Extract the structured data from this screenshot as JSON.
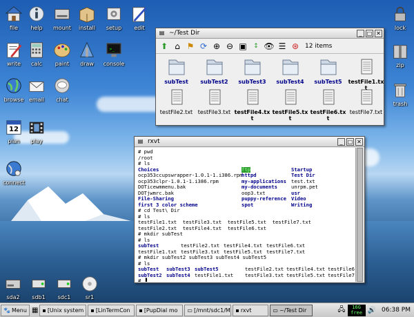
{
  "desktop_left": [
    {
      "name": "file",
      "icon": "home-icon",
      "col": 0,
      "row": 0
    },
    {
      "name": "help",
      "icon": "info-icon",
      "col": 1,
      "row": 0
    },
    {
      "name": "mount",
      "icon": "drive-icon",
      "col": 2,
      "row": 0
    },
    {
      "name": "install",
      "icon": "package-icon",
      "col": 3,
      "row": 0
    },
    {
      "name": "setup",
      "icon": "setup-icon",
      "col": 4,
      "row": 0
    },
    {
      "name": "edit",
      "icon": "edit-icon",
      "col": 5,
      "row": 0
    },
    {
      "name": "write",
      "icon": "write-icon",
      "col": 0,
      "row": 1
    },
    {
      "name": "calc",
      "icon": "calculator-icon",
      "col": 1,
      "row": 1
    },
    {
      "name": "paint",
      "icon": "paint-icon",
      "col": 2,
      "row": 1
    },
    {
      "name": "draw",
      "icon": "draw-icon",
      "col": 3,
      "row": 1
    },
    {
      "name": "console",
      "icon": "monitor-icon",
      "col": 4,
      "row": 1
    },
    {
      "name": "browse",
      "icon": "globe-icon",
      "col": 0,
      "row": 2
    },
    {
      "name": "email",
      "icon": "email-icon",
      "col": 1,
      "row": 2
    },
    {
      "name": "chat",
      "icon": "chat-icon",
      "col": 2,
      "row": 2
    },
    {
      "name": "plan",
      "icon": "calendar-icon",
      "col": 0,
      "row": 3
    },
    {
      "name": "play",
      "icon": "film-icon",
      "col": 1,
      "row": 3
    },
    {
      "name": "connect",
      "icon": "network-icon",
      "col": 0,
      "row": 4
    }
  ],
  "calendar_day": "12",
  "desktop_right": [
    {
      "name": "lock",
      "icon": "lock-icon"
    },
    {
      "name": "zip",
      "icon": "zip-icon"
    },
    {
      "name": "trash",
      "icon": "trash-icon"
    }
  ],
  "drives": [
    {
      "name": "sda2"
    },
    {
      "name": "sdb1"
    },
    {
      "name": "sdc1"
    },
    {
      "name": "sr1"
    }
  ],
  "file_window": {
    "title": "~/Test Dir",
    "item_count": "12 items",
    "items": [
      {
        "name": "subTest",
        "type": "folder"
      },
      {
        "name": "subTest2",
        "type": "folder"
      },
      {
        "name": "subTest3",
        "type": "folder"
      },
      {
        "name": "subTest4",
        "type": "folder"
      },
      {
        "name": "subTest5",
        "type": "folder"
      },
      {
        "name": "testFile1.txt",
        "type": "file",
        "bold": true
      },
      {
        "name": "testFile2.txt",
        "type": "file"
      },
      {
        "name": "testFile3.txt",
        "type": "file"
      },
      {
        "name": "testFile4.txt",
        "type": "file",
        "bold": true
      },
      {
        "name": "testFile5.txt",
        "type": "file",
        "bold": true
      },
      {
        "name": "testFile6.txt",
        "type": "file",
        "bold": true
      },
      {
        "name": "testFile7.txt",
        "type": "file"
      }
    ]
  },
  "terminal": {
    "title": "rxvt",
    "lines": [
      [
        {
          "t": "# pwd"
        }
      ],
      [
        {
          "t": "/root"
        }
      ],
      [
        {
          "t": "# ls"
        }
      ],
      [
        {
          "t": "Choices",
          "cls": "dir",
          "col": 0
        },
        {
          "t": "ftp",
          "cls": "hl",
          "col": 150
        },
        {
          "t": "Startup",
          "cls": "dir",
          "col": 222
        }
      ],
      [
        {
          "t": "ocp353ccupswrapper-1.0.1-1.i386.rpm",
          "col": 0
        },
        {
          "t": "httpd",
          "cls": "dir",
          "col": 150
        },
        {
          "t": "Test Dir",
          "cls": "dir",
          "col": 222
        }
      ],
      [
        {
          "t": "ocp353clpr-1.0.1-1.i386.rpm",
          "col": 0
        },
        {
          "t": "my-applications",
          "cls": "dir",
          "col": 150
        },
        {
          "t": "test.txt",
          "col": 222
        }
      ],
      [
        {
          "t": "DOTicewmmenu.bak",
          "col": 0
        },
        {
          "t": "my-documents",
          "cls": "dir",
          "col": 150
        },
        {
          "t": "unrpm.pet",
          "col": 222
        }
      ],
      [
        {
          "t": "DOTjwmrc.bak",
          "col": 0
        },
        {
          "t": "oop3.txt",
          "col": 150
        },
        {
          "t": "usr",
          "cls": "dir",
          "col": 222
        }
      ],
      [
        {
          "t": "File-Sharing",
          "cls": "dir",
          "col": 0
        },
        {
          "t": "puppy-reference",
          "cls": "dir",
          "col": 150
        },
        {
          "t": "Video",
          "cls": "dir",
          "col": 222
        }
      ],
      [
        {
          "t": "first 3 color scheme",
          "cls": "dir",
          "col": 0
        },
        {
          "t": "spot",
          "cls": "dir",
          "col": 150
        },
        {
          "t": "Writing",
          "cls": "dir",
          "col": 222
        }
      ],
      [
        {
          "t": "# cd Test\\ Dir"
        }
      ],
      [
        {
          "t": "# ls"
        }
      ],
      [
        {
          "t": "testFile1.txt  testFile3.txt  testFile5.txt  testFile7.txt"
        }
      ],
      [
        {
          "t": "testFile2.txt  testFile4.txt  testFile6.txt"
        }
      ],
      [
        {
          "t": "# mkdir subTest"
        }
      ],
      [
        {
          "t": "# ls"
        }
      ],
      [
        {
          "t": "subTest",
          "cls": "dir",
          "col": 0
        },
        {
          "t": "testFile2.txt",
          "col": 62
        },
        {
          "t": "testFile4.txt",
          "col": 124
        },
        {
          "t": "testFile6.txt",
          "col": 186
        }
      ],
      [
        {
          "t": "testFile1.txt",
          "col": 0
        },
        {
          "t": "testFile3.txt",
          "col": 62
        },
        {
          "t": "testFile5.txt",
          "col": 124
        },
        {
          "t": "testFile7.txt",
          "col": 186
        }
      ],
      [
        {
          "t": "# mkdir subTest2 subTest3 subTest4 subTest5"
        }
      ],
      [
        {
          "t": "# ls"
        }
      ],
      [
        {
          "t": "subTest",
          "cls": "dir",
          "col": 0
        },
        {
          "t": "subTest3",
          "cls": "dir",
          "col": 41
        },
        {
          "t": "subTest5",
          "cls": "dir",
          "col": 82
        },
        {
          "t": "testFile2.txt",
          "col": 155
        },
        {
          "t": "testFile4.txt",
          "col": 215
        },
        {
          "t": "testFile6.txt",
          "col": 275
        }
      ],
      [
        {
          "t": "subTest2",
          "cls": "dir",
          "col": 0
        },
        {
          "t": "subTest4",
          "cls": "dir",
          "col": 41
        },
        {
          "t": "testFile1.txt",
          "col": 82
        },
        {
          "t": "testFile3.txt",
          "col": 155
        },
        {
          "t": "testFile5.txt",
          "col": 215
        },
        {
          "t": "testFile7.txt",
          "col": 275
        }
      ],
      [
        {
          "t": "# ▐"
        }
      ]
    ]
  },
  "taskbar": {
    "menu_label": "Menu",
    "tasks": [
      {
        "label": "[Unix system",
        "active": false
      },
      {
        "label": "[LinTermCon",
        "active": false
      },
      {
        "label": "[PupDial mo",
        "active": false
      },
      {
        "label": "[/mnt/sdc1/M",
        "active": false
      },
      {
        "label": "rxvt",
        "active": false
      },
      {
        "label": "~/Test Dir",
        "active": true
      }
    ],
    "mem": "16G free",
    "clock": "06:38 PM"
  }
}
